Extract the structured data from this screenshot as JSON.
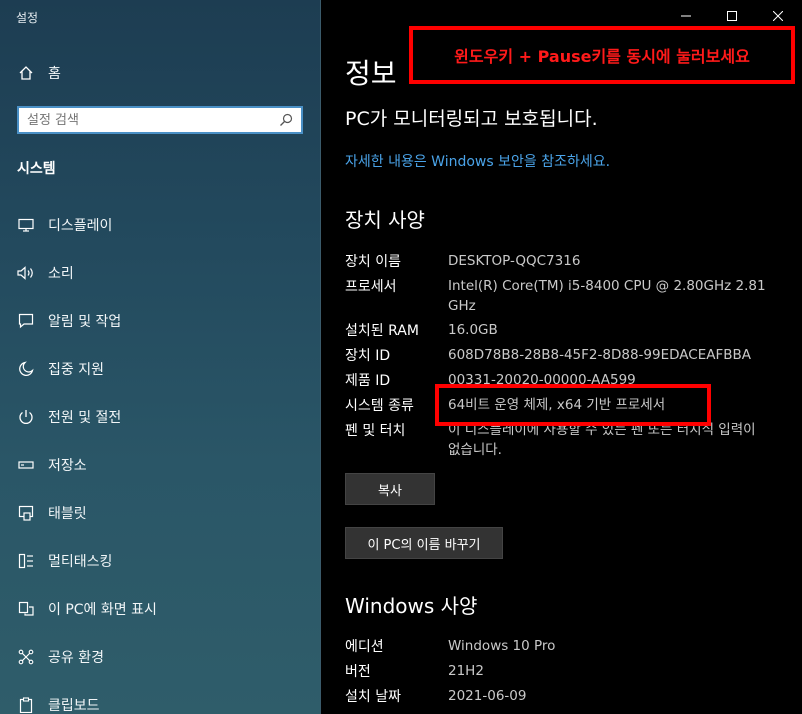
{
  "window": {
    "title": "설정"
  },
  "sidebar": {
    "home_label": "홈",
    "search_placeholder": "설정 검색",
    "section_title": "시스템",
    "items": [
      {
        "label": "디스플레이",
        "icon": "monitor-icon"
      },
      {
        "label": "소리",
        "icon": "speaker-icon"
      },
      {
        "label": "알림 및 작업",
        "icon": "notification-icon"
      },
      {
        "label": "집중 지원",
        "icon": "moon-icon"
      },
      {
        "label": "전원 및 절전",
        "icon": "power-icon"
      },
      {
        "label": "저장소",
        "icon": "storage-icon"
      },
      {
        "label": "태블릿",
        "icon": "tablet-icon"
      },
      {
        "label": "멀티태스킹",
        "icon": "multitask-icon"
      },
      {
        "label": "이 PC에 화면 표시",
        "icon": "project-icon"
      },
      {
        "label": "공유 환경",
        "icon": "share-icon"
      },
      {
        "label": "클립보드",
        "icon": "clipboard-icon"
      }
    ]
  },
  "main": {
    "title": "정보",
    "protection_status": "PC가 모니터링되고 보호됩니다.",
    "security_link": "자세한 내용은 Windows 보안을 참조하세요.",
    "device_specs": {
      "heading": "장치 사양",
      "rows": [
        {
          "label": "장치 이름",
          "value": "DESKTOP-QQC7316"
        },
        {
          "label": "프로세서",
          "value": "Intel(R) Core(TM) i5-8400 CPU @ 2.80GHz   2.81 GHz"
        },
        {
          "label": "설치된 RAM",
          "value": "16.0GB"
        },
        {
          "label": "장치 ID",
          "value": "608D78B8-28B8-45F2-8D88-99EDACEAFBBA"
        },
        {
          "label": "제품 ID",
          "value": "00331-20020-00000-AA599"
        },
        {
          "label": "시스템 종류",
          "value": "64비트 운영 체제, x64 기반 프로세서"
        },
        {
          "label": "펜 및 터치",
          "value": "이 디스플레이에 사용할 수 있는 펜 또는 터치식 입력이 없습니다."
        }
      ],
      "copy_button": "복사",
      "rename_button": "이 PC의 이름 바꾸기"
    },
    "windows_specs": {
      "heading": "Windows 사양",
      "rows": [
        {
          "label": "에디션",
          "value": "Windows 10 Pro"
        },
        {
          "label": "버전",
          "value": "21H2"
        },
        {
          "label": "설치 날짜",
          "value": "2021-06-09"
        }
      ]
    }
  },
  "annotation": {
    "banner_text": "윈도우키 + Pause키를 동시에 눌러보세요",
    "color": "#ff0000"
  }
}
